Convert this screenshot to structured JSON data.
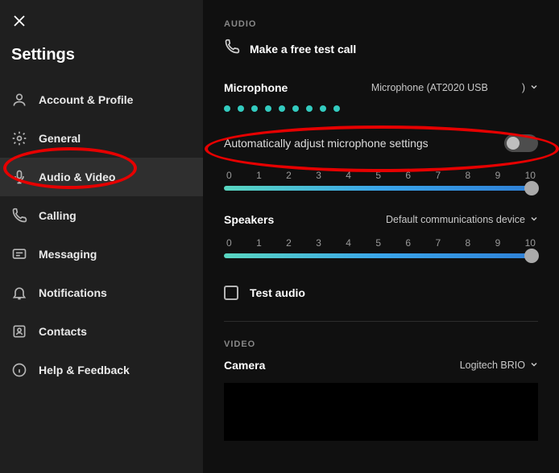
{
  "sidebar": {
    "title": "Settings",
    "items": [
      {
        "label": "Account & Profile"
      },
      {
        "label": "General"
      },
      {
        "label": "Audio & Video"
      },
      {
        "label": "Calling"
      },
      {
        "label": "Messaging"
      },
      {
        "label": "Notifications"
      },
      {
        "label": "Contacts"
      },
      {
        "label": "Help & Feedback"
      }
    ]
  },
  "main": {
    "audio_section": "AUDIO",
    "test_call": "Make a free test call",
    "microphone": {
      "title": "Microphone",
      "value": "Microphone (AT2020 USB",
      "value_suffix": ")",
      "auto_adjust": "Automatically adjust microphone settings",
      "scale": [
        "0",
        "1",
        "2",
        "3",
        "4",
        "5",
        "6",
        "7",
        "8",
        "9",
        "10"
      ]
    },
    "speakers": {
      "title": "Speakers",
      "value": "Default communications device",
      "scale": [
        "0",
        "1",
        "2",
        "3",
        "4",
        "5",
        "6",
        "7",
        "8",
        "9",
        "10"
      ]
    },
    "test_audio": "Test audio",
    "video_section": "VIDEO",
    "camera": {
      "title": "Camera",
      "value": "Logitech BRIO"
    }
  }
}
